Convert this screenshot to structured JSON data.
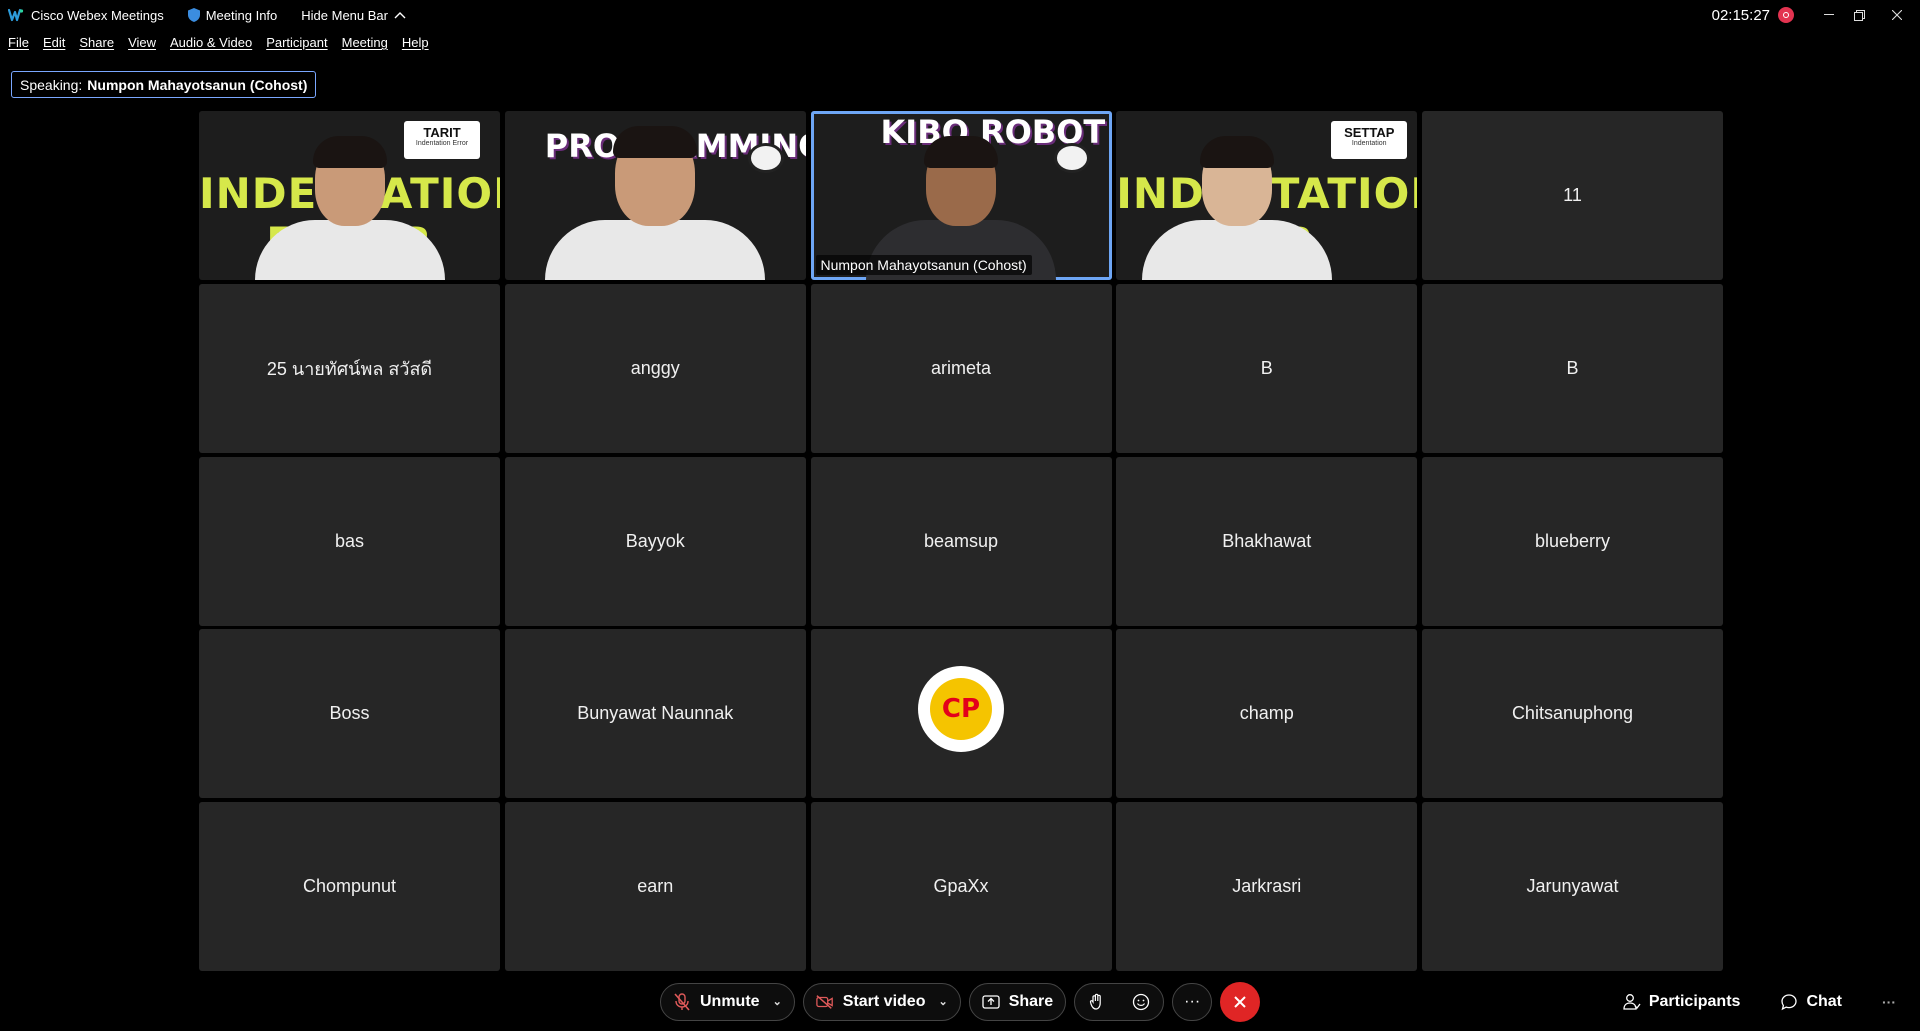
{
  "titlebar": {
    "app_name": "Cisco Webex Meetings",
    "meeting_info": "Meeting Info",
    "hide_menu": "Hide Menu Bar",
    "clock": "02:15:27"
  },
  "menu": [
    "File",
    "Edit",
    "Share",
    "View",
    "Audio & Video",
    "Participant",
    "Meeting",
    "Help"
  ],
  "speaking": {
    "prefix": "Speaking:",
    "name": "Numpon Mahayotsanun (Cohost)"
  },
  "video_tiles": {
    "tile1": {
      "banner": "INDENTATION ERROR",
      "tag_title": "TARIT",
      "tag_sub": "Indentation Error"
    },
    "tile2": {
      "banner": "PROGRAMMING"
    },
    "tile3": {
      "banner": "KIBO ROBOT",
      "label": "Numpon Mahayotsanun (Cohost)"
    },
    "tile4": {
      "banner": "INDENTATION ERR",
      "tag_title": "SETTAP",
      "tag_sub": "Indentation"
    }
  },
  "participants": [
    "11",
    "25 นายทัศน์พล สวัสดี",
    "anggy",
    "arimeta",
    "B",
    "B",
    "bas",
    "Bayyok",
    "beamsup",
    "Bhakhawat",
    "blueberry",
    "Boss",
    "Bunyawat Naunnak",
    "",
    "champ",
    "Chitsanuphong",
    "Chompunut",
    "earn",
    "GpaXx",
    "Jarkrasri",
    "Jarunyawat"
  ],
  "cp_avatar_text": "CP",
  "controls": {
    "unmute": "Unmute",
    "start_video": "Start video",
    "share": "Share",
    "more": "···",
    "participants": "Participants",
    "chat": "Chat"
  },
  "colors": {
    "active_border": "#6ea6f5",
    "end_call": "#e02525",
    "tile_bg": "#262626"
  }
}
